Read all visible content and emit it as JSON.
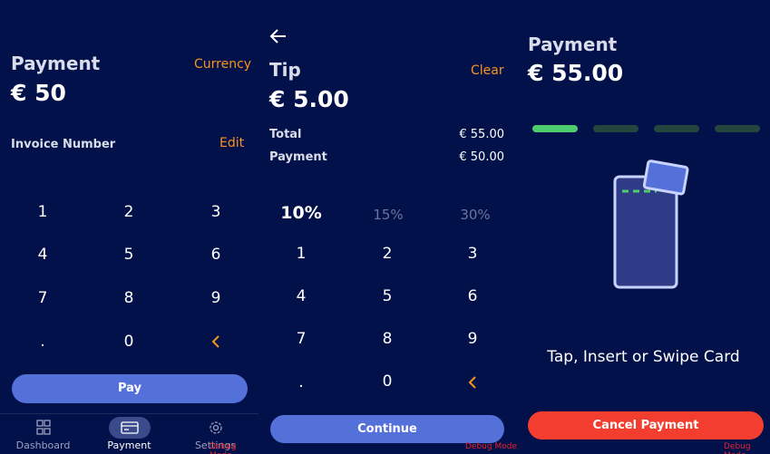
{
  "screen1": {
    "title": "Payment",
    "currency_link": "Currency",
    "amount": "€ 50",
    "invoice_label": "Invoice Number",
    "edit_link": "Edit",
    "keys": [
      "1",
      "2",
      "3",
      "4",
      "5",
      "6",
      "7",
      "8",
      "9",
      ".",
      "0"
    ],
    "backspace": "‹",
    "pay_label": "Pay",
    "nav": [
      {
        "label": "Dashboard",
        "icon": "grid-icon"
      },
      {
        "label": "Payment",
        "icon": "card-icon"
      },
      {
        "label": "Settings",
        "icon": "gear-icon"
      }
    ],
    "debug": "Debug Mode"
  },
  "screen2": {
    "back_icon": "arrow-left-icon",
    "title": "Tip",
    "clear_link": "Clear",
    "amount": "€ 5.00",
    "total_label": "Total",
    "total_value": "€ 55.00",
    "payment_label": "Payment",
    "payment_value": "€ 50.00",
    "tip_options": [
      "10%",
      "15%",
      "30%"
    ],
    "selected_tip": "10%",
    "keys": [
      "1",
      "2",
      "3",
      "4",
      "5",
      "6",
      "7",
      "8",
      "9",
      ".",
      "0"
    ],
    "backspace": "‹",
    "continue_label": "Continue",
    "debug": "Debug Mode"
  },
  "screen3": {
    "title": "Payment",
    "amount": "€ 55.00",
    "progress_steps": 4,
    "progress_active": 1,
    "instruction": "Tap, Insert or Swipe Card",
    "cancel_label": "Cancel Payment",
    "debug": "Debug Mode"
  },
  "colors": {
    "background": "#03114a",
    "accent_orange": "#f5941e",
    "button_blue": "#5470d9",
    "button_red": "#f33e2f",
    "progress_active": "#4ccd6e",
    "progress_inactive": "#24463f"
  }
}
